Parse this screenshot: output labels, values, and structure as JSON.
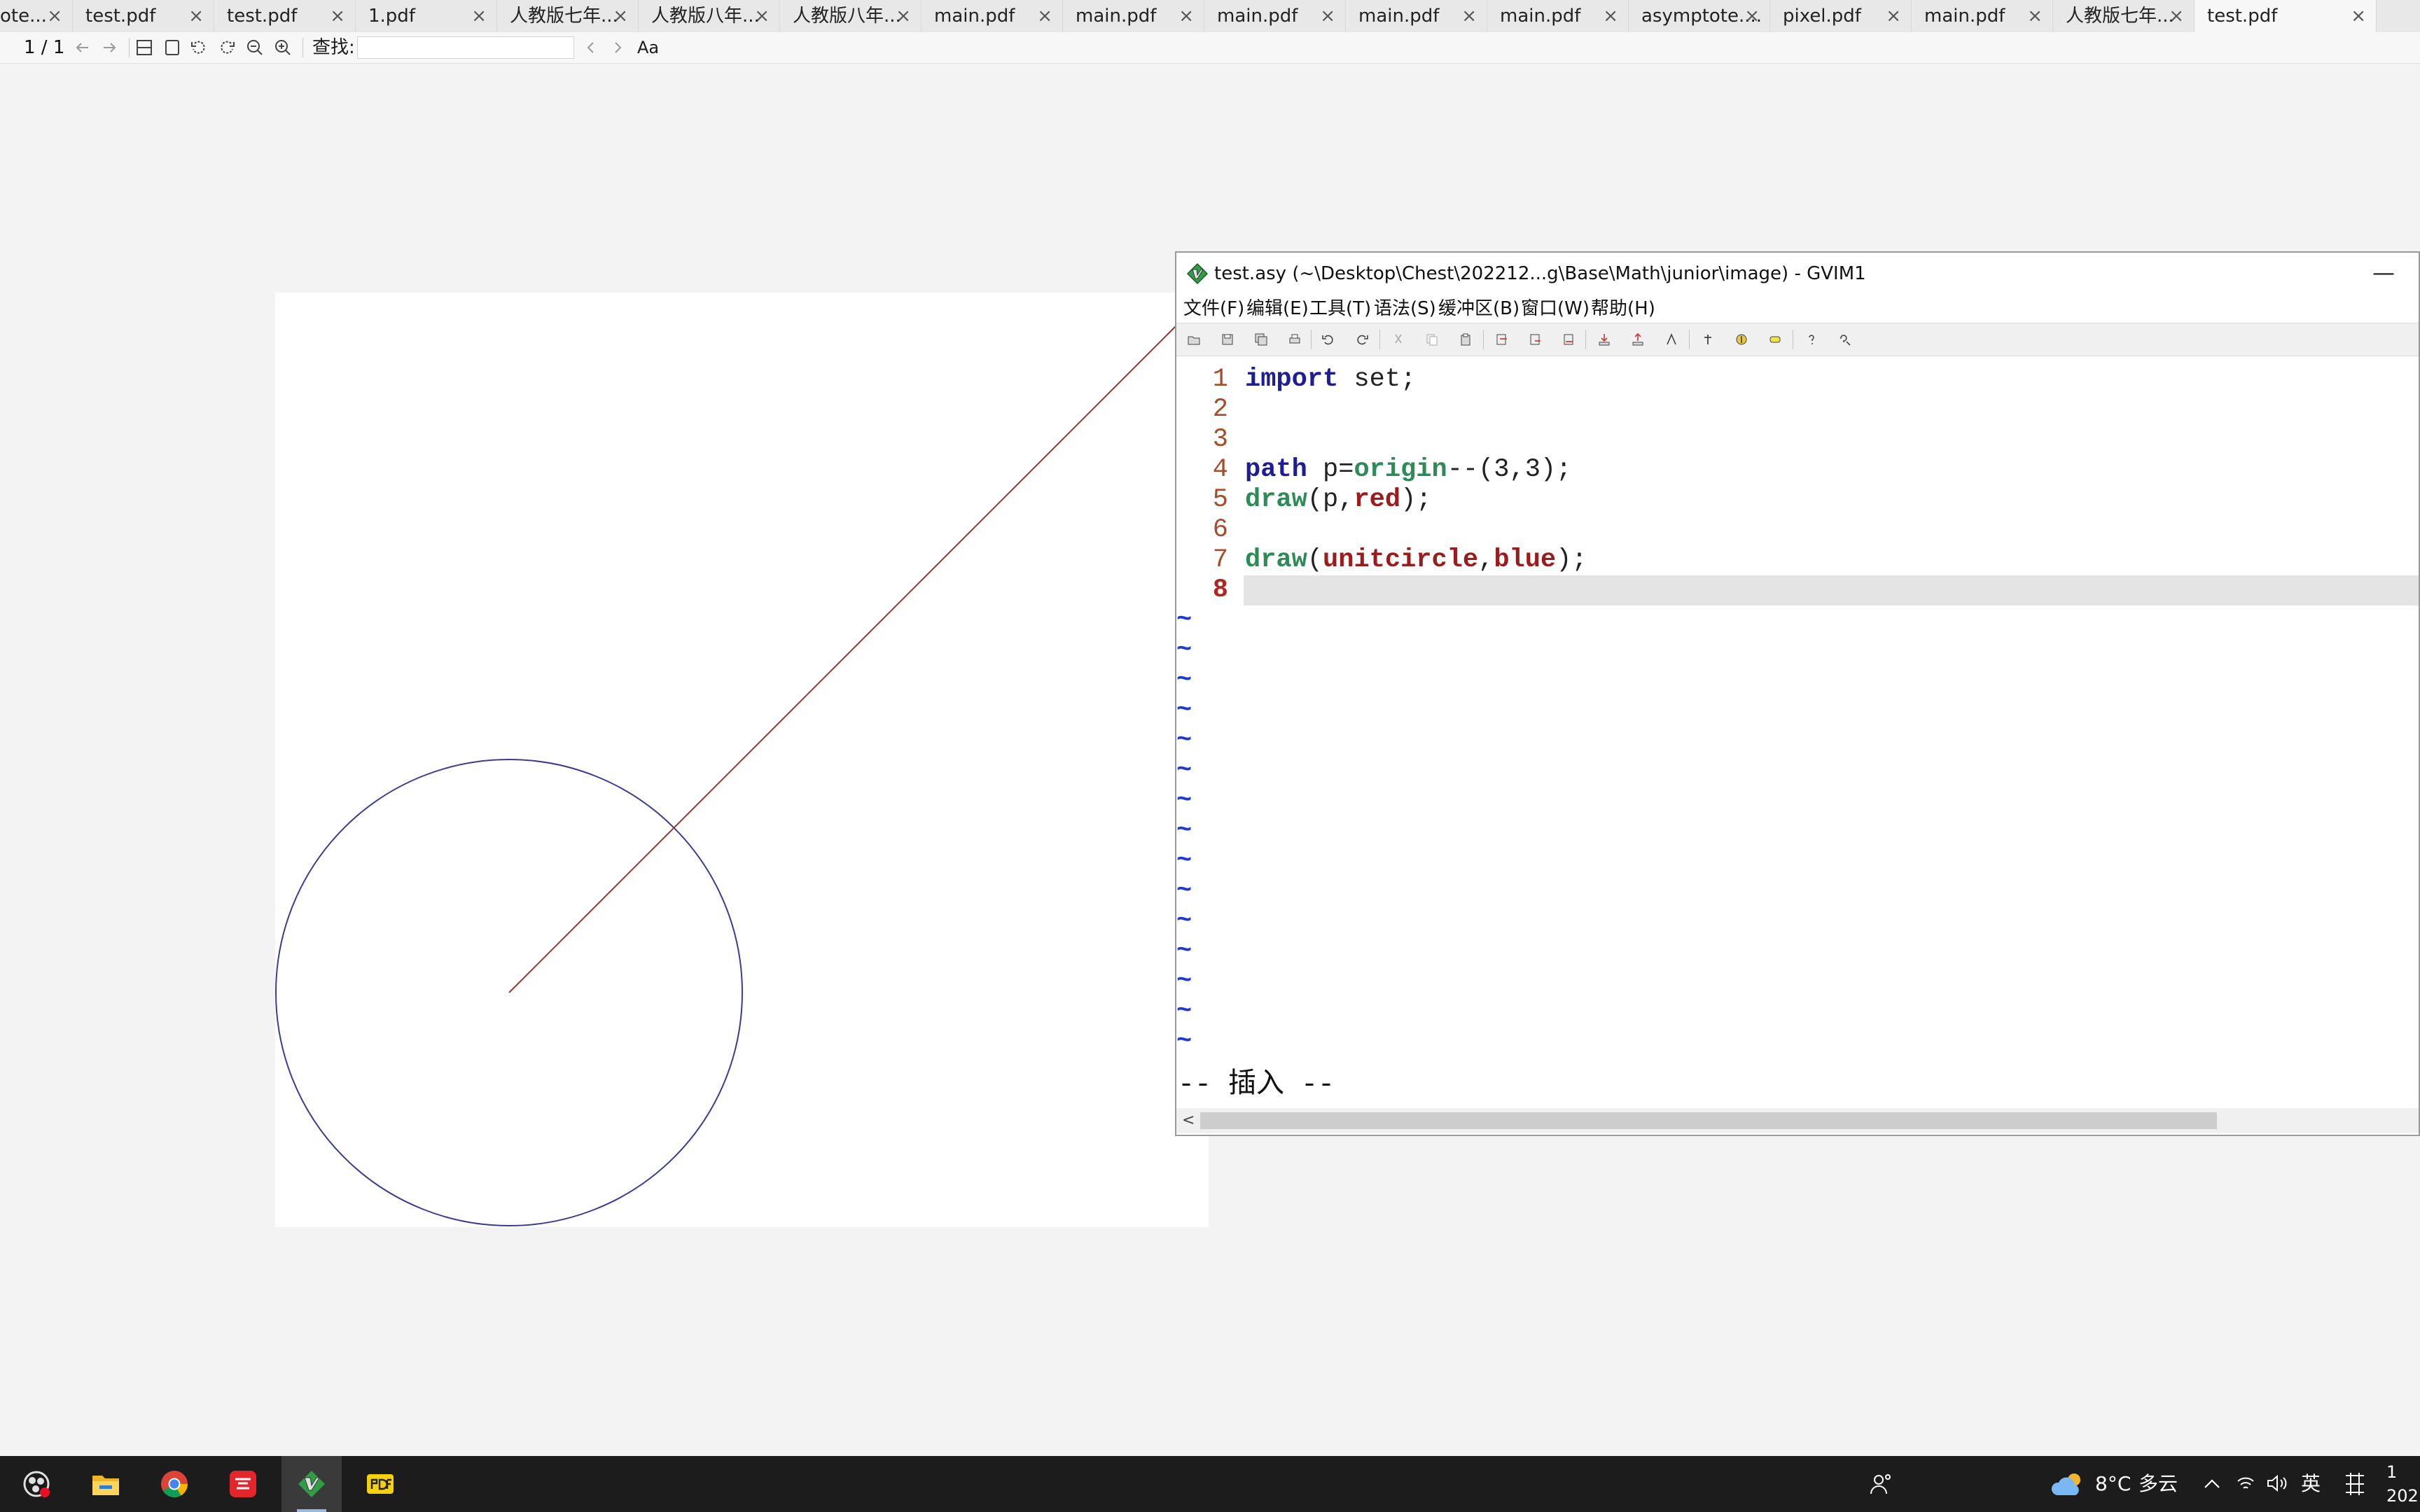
{
  "pdf_viewer": {
    "tabs": [
      {
        "label": "ote...",
        "active": false
      },
      {
        "label": "test.pdf",
        "active": false
      },
      {
        "label": "test.pdf",
        "active": false
      },
      {
        "label": "1.pdf",
        "active": false
      },
      {
        "label": "人教版七年...",
        "active": false
      },
      {
        "label": "人教版八年...",
        "active": false
      },
      {
        "label": "人教版八年...",
        "active": false
      },
      {
        "label": "main.pdf",
        "active": false
      },
      {
        "label": "main.pdf",
        "active": false
      },
      {
        "label": "main.pdf",
        "active": false
      },
      {
        "label": "main.pdf",
        "active": false
      },
      {
        "label": "main.pdf",
        "active": false
      },
      {
        "label": "asymptote....",
        "active": false
      },
      {
        "label": "pixel.pdf",
        "active": false
      },
      {
        "label": "main.pdf",
        "active": false
      },
      {
        "label": "人教版七年...",
        "active": false
      },
      {
        "label": "test.pdf",
        "active": true
      }
    ],
    "tab_close_glyph": "×",
    "page_indicator": "1 / 1",
    "find_label": "查找:",
    "find_value": "",
    "match_case_glyph": "Aa",
    "line_color": "#a0322a",
    "circle_color": "#3c3c96"
  },
  "gvim": {
    "title": "test.asy (~\\Desktop\\Chest\\202212...g\\Base\\Math\\junior\\image) - GVIM1",
    "minimize_glyph": "—",
    "menu": [
      "文件(F)",
      "编辑(E)",
      "工具(T)",
      "语法(S)",
      "缓冲区(B)",
      "窗口(W)",
      "帮助(H)"
    ],
    "lines": [
      {
        "num": "1",
        "code": "import set;"
      },
      {
        "num": "2",
        "code": ""
      },
      {
        "num": "3",
        "code": ""
      },
      {
        "num": "4",
        "code": "path p=origin--(3,3);"
      },
      {
        "num": "5",
        "code": "draw(p,red);"
      },
      {
        "num": "6",
        "code": ""
      },
      {
        "num": "7",
        "code": "draw(unitcircle,blue);"
      },
      {
        "num": "8",
        "code": ""
      }
    ],
    "tilde": "~",
    "mode": "-- 插入 --",
    "scroll_left_glyph": "<"
  },
  "taskbar": {
    "weather_temp": "8°C",
    "weather_desc": "多云",
    "ime": "英",
    "clock_time": "1",
    "clock_date": "202"
  }
}
